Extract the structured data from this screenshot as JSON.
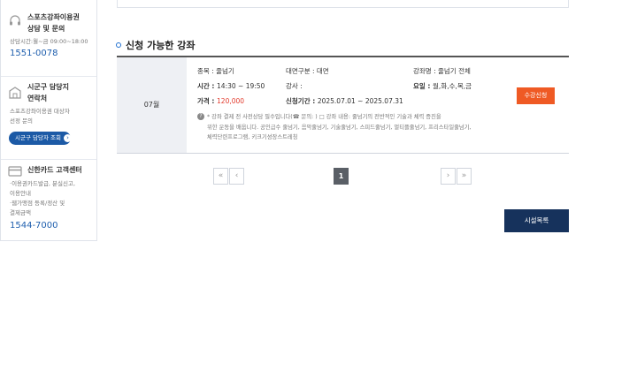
{
  "sidebar": {
    "sports_card": {
      "title_line1": "스포츠강좌이용권",
      "title_line2": "상담 및 문의",
      "hours": "상담시간:월~금 09:00~18:00",
      "phone": "1551-0078"
    },
    "local_contact": {
      "title_line1": "시군구 담당지",
      "title_line2": "연락처",
      "desc_line1": "스포츠강좌이용권 대상자",
      "desc_line2": "선정 문의",
      "button": "시군구 담당자 조회"
    },
    "shinhan": {
      "title": "신한카드 고객센터",
      "line1": "·이용권카드발급, 분실신고,",
      "line2": "이용안내",
      "line3": "·웹가맹점 등록/정산 및",
      "line4": "결제금액",
      "phone": "1544-7000"
    }
  },
  "section": {
    "title": "신청 가능한 강좌"
  },
  "course": {
    "month": "07월",
    "event": "종목 : 줄넘기",
    "time_label": "시간 : ",
    "time_value": "14:30 ~ 19:50",
    "price_label": "가격 : ",
    "price_value": "120,000",
    "target": "대면구분 : 대면",
    "instructor": "강사 : ",
    "period_label": "신청기간 : ",
    "period_value": "2025.07.01 ~ 2025.07.31",
    "course_name": "강좌명 : 줄넘기 전체",
    "days_label": "요일 : ",
    "days_value": "월,화,수,목,금",
    "apply_button": "수강신청",
    "notice_line1": "* 강좌 결제 전 사전상담 필수입니다(☎ 문의:                    ) □ 강좌 내용: 줄넘기의 전반적인 기술과 체력 증진을",
    "notice_line2": "위한 운동을 배웁니다. 공인급수 줄넘기, 음악줄넘기, 기술줄넘기, 스피드줄넘기, 멀티플줄넘기, 프리스타일줄넘기,",
    "notice_line3": "체력단련프로그램, 키크기성장스트레칭"
  },
  "pagination": {
    "first": "«",
    "prev": "‹",
    "current": "1",
    "next": "›",
    "last": "»"
  },
  "actions": {
    "list_button": "시설목록"
  },
  "colors": {
    "accent_blue": "#1c5aa6",
    "apply_orange": "#ef5a24",
    "navy": "#16325c",
    "price_red": "#e23a2c"
  }
}
